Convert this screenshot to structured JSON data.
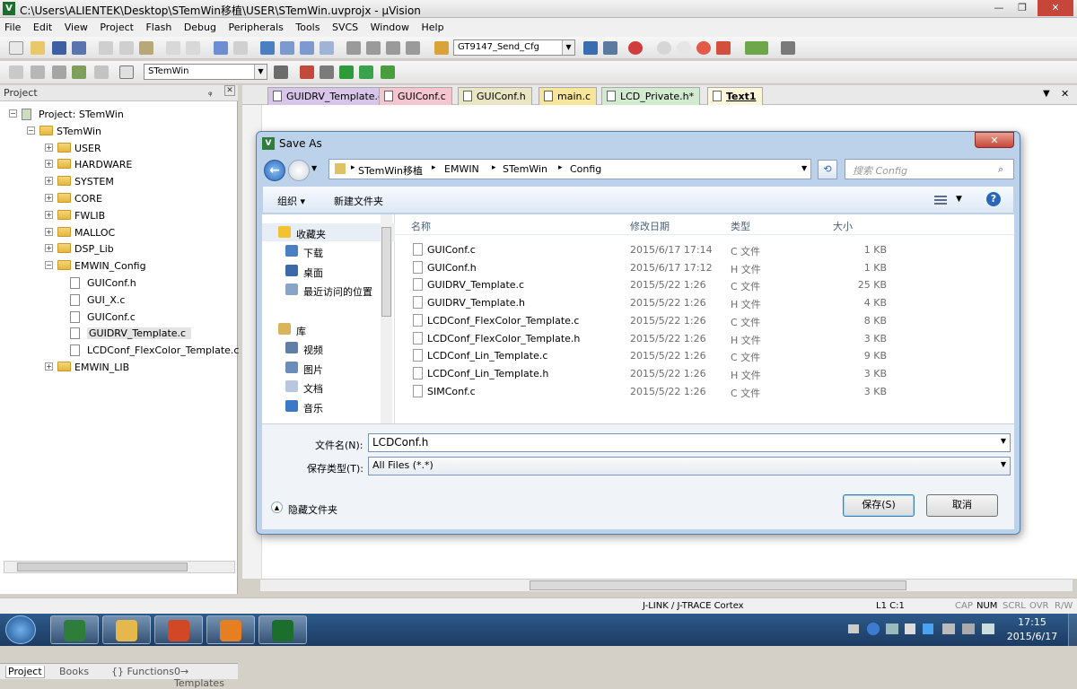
{
  "window": {
    "title": "C:\\Users\\ALIENTEK\\Desktop\\STemWin移植\\USER\\STemWin.uvprojx - µVision",
    "min": "—",
    "max": "❐",
    "close": "✕"
  },
  "menu": [
    "File",
    "Edit",
    "View",
    "Project",
    "Flash",
    "Debug",
    "Peripherals",
    "Tools",
    "SVCS",
    "Window",
    "Help"
  ],
  "toolbar": {
    "target_combo": "GT9147_Send_Cfg",
    "project_combo": "STemWin"
  },
  "project_pane": {
    "title": "Project",
    "pin": "ᵩ",
    "close": "✕",
    "tree": [
      {
        "label": "Project: STemWin",
        "level": 0,
        "toggle": "−"
      },
      {
        "label": "STemWin",
        "level": 1,
        "toggle": "−"
      },
      {
        "label": "USER",
        "level": 2,
        "toggle": "+"
      },
      {
        "label": "HARDWARE",
        "level": 2,
        "toggle": "+"
      },
      {
        "label": "SYSTEM",
        "level": 2,
        "toggle": "+"
      },
      {
        "label": "CORE",
        "level": 2,
        "toggle": "+"
      },
      {
        "label": "FWLIB",
        "level": 2,
        "toggle": "+"
      },
      {
        "label": "MALLOC",
        "level": 2,
        "toggle": "+"
      },
      {
        "label": "DSP_Lib",
        "level": 2,
        "toggle": "+"
      },
      {
        "label": "EMWIN_Config",
        "level": 2,
        "toggle": "−"
      },
      {
        "label": "GUIConf.h",
        "level": 3
      },
      {
        "label": "GUI_X.c",
        "level": 3
      },
      {
        "label": "GUIConf.c",
        "level": 3
      },
      {
        "label": "GUIDRV_Template.c",
        "level": 3
      },
      {
        "label": "LCDConf_FlexColor_Template.c",
        "level": 3
      },
      {
        "label": "EMWIN_LIB",
        "level": 2,
        "toggle": "+"
      }
    ],
    "bottom_tabs": [
      "Project",
      "Books",
      "{} Functions",
      "0→ Templates"
    ]
  },
  "editor_tabs": [
    {
      "label": "GUIDRV_Template.c",
      "color": "#d8c6ea"
    },
    {
      "label": "GUIConf.c",
      "color": "#f6c6d0"
    },
    {
      "label": "GUIConf.h",
      "color": "#e9e6c4"
    },
    {
      "label": "main.c",
      "color": "#f7e59a"
    },
    {
      "label": "LCD_Private.h*",
      "color": "#d1ead0"
    },
    {
      "label": "Text1",
      "color": "#fdf6d8"
    }
  ],
  "dialog": {
    "title": "Save As",
    "close": "✕",
    "address": [
      "STemWin移植",
      "EMWIN",
      "STemWin",
      "Config"
    ],
    "search_placeholder": "搜索 Config",
    "organize": "组织 ▾",
    "new_folder": "新建文件夹",
    "help": "?",
    "columns": {
      "name": "名称",
      "date": "修改日期",
      "type": "类型",
      "size": "大小"
    },
    "nav": {
      "favorites_header": "收藏夹",
      "favorites": [
        {
          "label": "下载",
          "color": "#4a7fc2"
        },
        {
          "label": "桌面",
          "color": "#3c6aa8"
        },
        {
          "label": "最近访问的位置",
          "color": "#8aa4c8"
        }
      ],
      "libraries_header": "库",
      "libraries": [
        {
          "label": "视频",
          "color": "#5f7fa9"
        },
        {
          "label": "图片",
          "color": "#6c8db9"
        },
        {
          "label": "文档",
          "color": "#b7c8de"
        },
        {
          "label": "音乐",
          "color": "#3b78c8"
        }
      ]
    },
    "files": [
      {
        "name": "GUIConf.c",
        "date": "2015/6/17 17:14",
        "type": "C 文件",
        "size": "1 KB"
      },
      {
        "name": "GUIConf.h",
        "date": "2015/6/17 17:12",
        "type": "H 文件",
        "size": "1 KB"
      },
      {
        "name": "GUIDRV_Template.c",
        "date": "2015/5/22 1:26",
        "type": "C 文件",
        "size": "25 KB"
      },
      {
        "name": "GUIDRV_Template.h",
        "date": "2015/5/22 1:26",
        "type": "H 文件",
        "size": "4 KB"
      },
      {
        "name": "LCDConf_FlexColor_Template.c",
        "date": "2015/5/22 1:26",
        "type": "C 文件",
        "size": "8 KB"
      },
      {
        "name": "LCDConf_FlexColor_Template.h",
        "date": "2015/5/22 1:26",
        "type": "H 文件",
        "size": "3 KB"
      },
      {
        "name": "LCDConf_Lin_Template.c",
        "date": "2015/5/22 1:26",
        "type": "C 文件",
        "size": "9 KB"
      },
      {
        "name": "LCDConf_Lin_Template.h",
        "date": "2015/5/22 1:26",
        "type": "H 文件",
        "size": "3 KB"
      },
      {
        "name": "SIMConf.c",
        "date": "2015/5/22 1:26",
        "type": "C 文件",
        "size": "3 KB"
      }
    ],
    "filename_label": "文件名(N):",
    "filename_value": "LCDConf.h",
    "filetype_label": "保存类型(T):",
    "filetype_value": "All Files (*.*)",
    "hide_folders": "隐藏文件夹",
    "save_button": "保存(S)",
    "cancel_button": "取消"
  },
  "statusbar": {
    "debugger": "J-LINK / J-TRACE Cortex",
    "position": "L1 C:1",
    "caps": "CAP",
    "num": "NUM",
    "scrl": "SCRL",
    "ovr": "OVR",
    "rw": "R/W"
  },
  "taskbar": {
    "time": "17:15",
    "date": "2015/6/17",
    "apps": [
      {
        "name": "keil-icon",
        "color": "#2f7d3a"
      },
      {
        "name": "explorer-icon",
        "color": "#e5b84c"
      },
      {
        "name": "powerpoint-icon",
        "color": "#d24726"
      },
      {
        "name": "foxit-icon",
        "color": "#e67e22"
      },
      {
        "name": "uvision-icon",
        "color": "#1c6e2d"
      }
    ]
  }
}
